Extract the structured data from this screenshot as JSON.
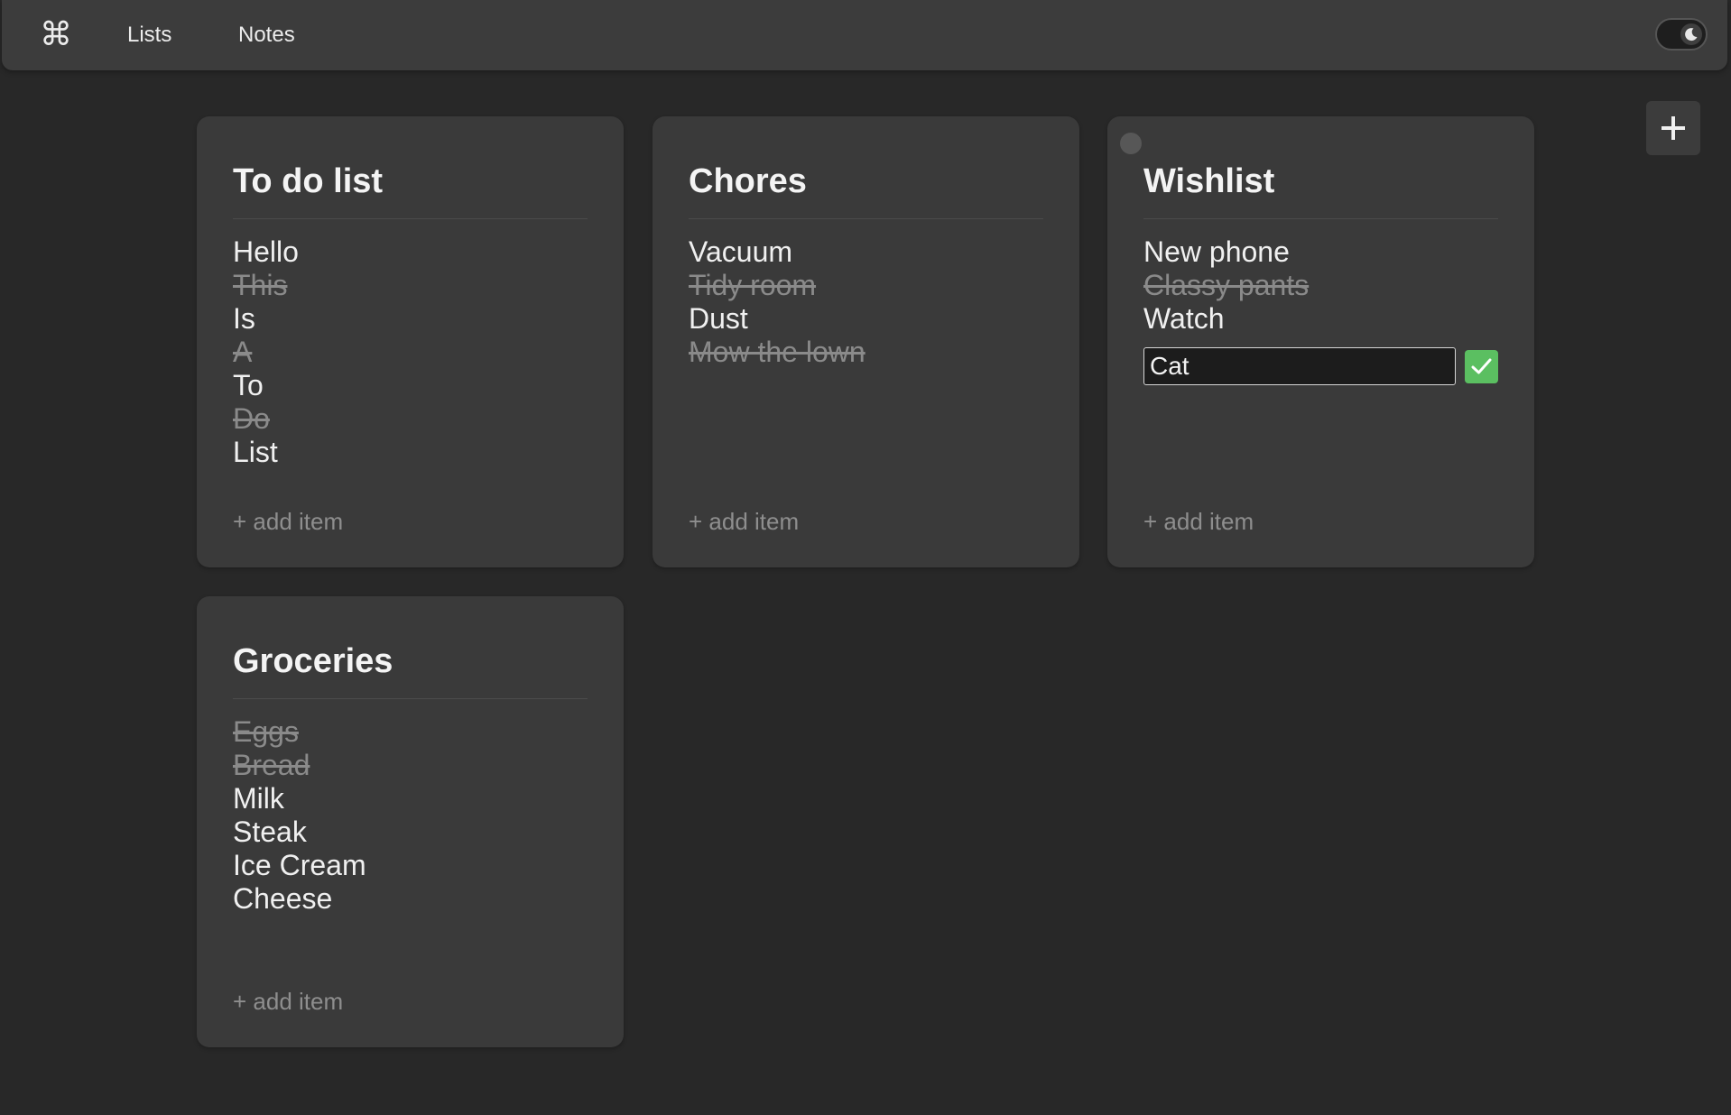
{
  "nav": {
    "logo_glyph": "⌘",
    "logo_icon": "command-icon",
    "links": [
      {
        "label": "Lists"
      },
      {
        "label": "Notes"
      }
    ],
    "theme_toggle_icon": "moon-icon"
  },
  "add_list_icon": "plus-icon",
  "cards": [
    {
      "title": "To do list",
      "items": [
        {
          "text": "Hello",
          "done": false
        },
        {
          "text": "This",
          "done": true
        },
        {
          "text": "Is",
          "done": false
        },
        {
          "text": "A",
          "done": true
        },
        {
          "text": "To",
          "done": false
        },
        {
          "text": "Do",
          "done": true
        },
        {
          "text": "List",
          "done": false
        }
      ],
      "add_label": "+ add item"
    },
    {
      "title": "Chores",
      "items": [
        {
          "text": "Vacuum",
          "done": false
        },
        {
          "text": "Tidy room",
          "done": true
        },
        {
          "text": "Dust",
          "done": false
        },
        {
          "text": "Mow the lown",
          "done": true
        }
      ],
      "add_label": "+ add item"
    },
    {
      "title": "Wishlist",
      "items": [
        {
          "text": "New phone",
          "done": false
        },
        {
          "text": "Classy pants",
          "done": true
        },
        {
          "text": "Watch",
          "done": false
        }
      ],
      "new_item_value": "Cat",
      "add_label": "+ add item"
    },
    {
      "title": "Groceries",
      "items": [
        {
          "text": "Eggs",
          "done": true
        },
        {
          "text": "Bread",
          "done": true
        },
        {
          "text": "Milk",
          "done": false
        },
        {
          "text": "Steak",
          "done": false
        },
        {
          "text": "Ice Cream",
          "done": false
        },
        {
          "text": "Cheese",
          "done": false
        }
      ],
      "add_label": "+ add item"
    }
  ],
  "colors": {
    "background": "#282828",
    "card": "#3a3a3a",
    "done_text": "#8a8a8a",
    "confirm_green": "#5bbf61"
  }
}
